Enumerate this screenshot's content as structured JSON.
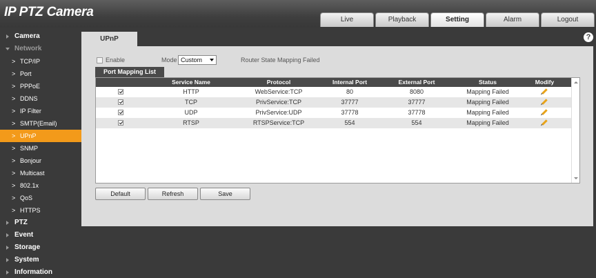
{
  "app": {
    "title": "IP PTZ Camera"
  },
  "tabs": [
    "Live",
    "Playback",
    "Setting",
    "Alarm",
    "Logout"
  ],
  "sidebar": {
    "camera": "Camera",
    "network": "Network",
    "network_items": [
      "TCP/IP",
      "Port",
      "PPPoE",
      "DDNS",
      "IP Filter",
      "SMTP(Email)",
      "UPnP",
      "SNMP",
      "Bonjour",
      "Multicast",
      "802.1x",
      "QoS",
      "HTTPS"
    ],
    "bottom": [
      "PTZ",
      "Event",
      "Storage",
      "System",
      "Information"
    ]
  },
  "page": {
    "title": "UPnP",
    "help": "?",
    "enable_label": "Enable",
    "mode_label": "Mode",
    "mode_value": "Custom",
    "router_state": "Router State Mapping Failed",
    "list_tab": "Port Mapping List",
    "columns": [
      "",
      "Service Name",
      "Protocol",
      "Internal Port",
      "External Port",
      "Status",
      "Modify"
    ],
    "rows": [
      {
        "service": "HTTP",
        "protocol": "WebService:TCP",
        "internal": "80",
        "external": "8080",
        "status": "Mapping Failed"
      },
      {
        "service": "TCP",
        "protocol": "PrivService:TCP",
        "internal": "37777",
        "external": "37777",
        "status": "Mapping Failed"
      },
      {
        "service": "UDP",
        "protocol": "PrivService:UDP",
        "internal": "37778",
        "external": "37778",
        "status": "Mapping Failed"
      },
      {
        "service": "RTSP",
        "protocol": "RTSPService:TCP",
        "internal": "554",
        "external": "554",
        "status": "Mapping Failed"
      }
    ],
    "buttons": {
      "default": "Default",
      "refresh": "Refresh",
      "save": "Save"
    }
  },
  "colors": {
    "active_nav": "#f39a1a",
    "header_dark": "#3f3f3f",
    "panel": "#dcdcdc"
  }
}
